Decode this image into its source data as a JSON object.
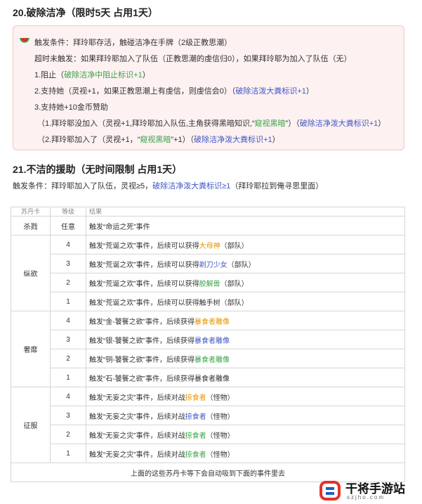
{
  "section20": {
    "title": "20.破除洁净（限时5天 占用1天）",
    "trigger": "触发条件：拜玲耶存活，触碰洁净在手牌（2级正教思潮）",
    "timeout": "超时未触发：如果拜玲耶加入了队伍（正教思潮的虔信归0），如果拜玲耶为加入了队伍（无）",
    "opt1_text": "1.阻止（",
    "opt1_link": "破除洁净中阻止标识+1",
    "opt1_end": "）",
    "opt2_text": "2.支持她（灵视+1，如果正教思潮上有虔信，则虔信会0）（",
    "opt2_link": "破除洁泼大粪标识+1",
    "opt2_end": "）",
    "opt3_text": "3.支持她+10金币赞助",
    "sub1_text": "（1.拜玲耶没加入（灵视+1,拜玲耶加入队伍,主角获得黑暗知识,“",
    "sub1_hl": "窥视黑暗",
    "sub1_mid": "”）（",
    "sub1_link": "破除洁净泼大粪标识+1",
    "sub1_end": "）",
    "sub2_text": "（2.拜玲耶加入了（灵视+1，“",
    "sub2_hl": "窥视黑暗",
    "sub2_mid": "”+1）（",
    "sub2_link": "破除洁净泼大粪标识+1",
    "sub2_end": "）"
  },
  "section21": {
    "title": "21.不洁的援助（无时间限制 占用1天）",
    "req_text": "触发条件：拜玲耶加入了队伍，灵视≥5，",
    "req_link": "破除洁净泼大粪标识≥1",
    "req_end": "（拜玲耶拉到俺寻思里面）"
  },
  "table": {
    "header": [
      "苏丹卡",
      "等级",
      "结果"
    ],
    "row_kill": {
      "card": "杀戮",
      "level": "任意",
      "result": "触发“命运之死”事件"
    },
    "zongyu": {
      "card": "纵欲",
      "rows": [
        {
          "level": "4",
          "pre": "触发“荒诞之欢”事件，后续可以获得",
          "hl": "大母神",
          "post": "（部队）",
          "hl_color": "#e69500"
        },
        {
          "level": "3",
          "pre": "触发“荒诞之欢”事件，后续可以获得",
          "hl": "剃刀少女",
          "post": "（部队）",
          "hl_color": "#3f57c8"
        },
        {
          "level": "2",
          "pre": "触发“荒诞之欢”事件，后续可以获得",
          "hl": "胶解兽",
          "post": "（部队）",
          "hl_color": "#3aa34a"
        },
        {
          "level": "1",
          "pre": "触发“荒诞之欢”事件，后续可以获得触手树（部队）",
          "hl": "",
          "post": "",
          "hl_color": "#333333"
        }
      ]
    },
    "shemi": {
      "card": "奢靡",
      "rows": [
        {
          "level": "4",
          "pre": "触发“金-饕餮之欲”事件，后续获得",
          "hl": "暴食者雕像",
          "post": "",
          "hl_color": "#e69500"
        },
        {
          "level": "3",
          "pre": "触发“银-饕餮之欲”事件，后续获得",
          "hl": "暴食者雕像",
          "post": "",
          "hl_color": "#3f57c8"
        },
        {
          "level": "2",
          "pre": "触发“铜-饕餮之欲”事件，后续获得",
          "hl": "暴食者雕像",
          "post": "",
          "hl_color": "#3aa34a"
        },
        {
          "level": "1",
          "pre": "触发“石-饕餮之欲”事件，后续获得暴食者雕像",
          "hl": "",
          "post": "",
          "hl_color": "#333333"
        }
      ]
    },
    "zhengfu": {
      "card": "征服",
      "rows": [
        {
          "level": "4",
          "pre": "触发“无妄之灾”事件，后续对战",
          "hl": "掠食者",
          "post": "（怪物）",
          "hl_color": "#e69500"
        },
        {
          "level": "3",
          "pre": "触发“无妄之灾”事件，后续对战",
          "hl": "掠食者",
          "post": "（怪物）",
          "hl_color": "#3f57c8"
        },
        {
          "level": "2",
          "pre": "触发“无妄之灾”事件，后续对战",
          "hl": "掠食者",
          "post": "（怪物）",
          "hl_color": "#3aa34a"
        },
        {
          "level": "1",
          "pre": "触发“无妄之灾”事件，后续对战",
          "hl": "掠食者",
          "post": "（怪物）",
          "hl_color": "#3aa34a"
        }
      ]
    },
    "footer": "上面的这些苏丹卡等下会自动吸到下面的事件里去"
  },
  "watermark": {
    "title": "干将手游站",
    "site": "szjho.com",
    "accent_red": "#e5322d",
    "accent_blue": "#1f5fbf"
  },
  "colors": {
    "callout_bg": "#fdf1f1",
    "callout_border": "#f0c8c8",
    "green": "#3aa34a",
    "blue": "#3f57c8",
    "orange": "#e69500"
  }
}
